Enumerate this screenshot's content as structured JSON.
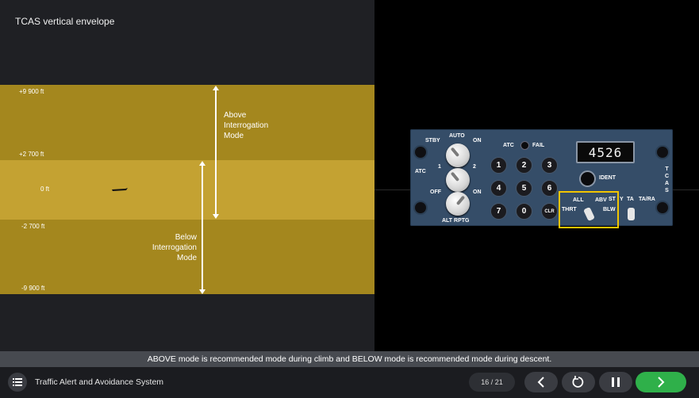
{
  "slide": {
    "title": "TCAS vertical envelope"
  },
  "envelope": {
    "altitudes": [
      "+9 900 ft",
      "+2 700 ft",
      "0 ft",
      "-2 700 ft",
      "-9 900 ft"
    ],
    "above_mode_label": [
      "Above",
      "Interrogation",
      "Mode"
    ],
    "below_mode_label": [
      "Below",
      "Interrogation",
      "Mode"
    ],
    "colors": {
      "outer_band": "#a4871e",
      "inner_band": "#c4a232"
    }
  },
  "panel": {
    "atc_side_label": "ATC",
    "tcas_side_label": "TCAS",
    "mode_knob": {
      "stby": "STBY",
      "auto": "AUTO",
      "on": "ON"
    },
    "xpdr_knob": {
      "one": "1",
      "two": "2"
    },
    "alt_knob": {
      "off": "OFF",
      "on": "ON",
      "label": "ALT RPTG"
    },
    "atc_fail": {
      "atc": "ATC",
      "fail": "FAIL"
    },
    "keys": [
      "1",
      "2",
      "3",
      "4",
      "5",
      "6",
      "7",
      "0",
      "CLR"
    ],
    "code": "4526",
    "ident": "IDENT",
    "range_switch": {
      "all": "ALL",
      "abv": "ABV",
      "thrt": "THRT",
      "blw": "BLW"
    },
    "tcas_switch": {
      "st": "ST",
      "y": "Y",
      "ta": "TA",
      "tara": "TA/RA"
    },
    "highlight_color": "#f2c500"
  },
  "caption": "ABOVE mode is recommended mode during climb and BELOW mode is recommended mode during descent.",
  "toolbar": {
    "course_title": "Traffic Alert and Avoidance System",
    "page_counter": "16 / 21",
    "menu_icon": "list-menu-icon",
    "prev_icon": "chevron-left-icon",
    "replay_icon": "replay-icon",
    "pause_icon": "pause-icon",
    "next_icon": "chevron-right-icon",
    "next_color": "#2fb04a"
  }
}
